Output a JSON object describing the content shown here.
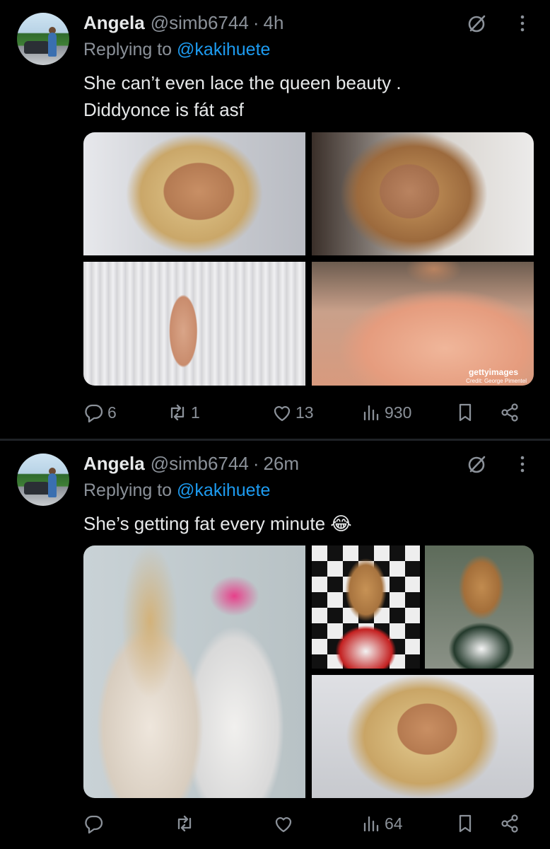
{
  "tweets": [
    {
      "author": {
        "name": "Angela",
        "handle": "@simb6744",
        "time": "4h"
      },
      "replying_to_label": "Replying to",
      "replying_to_handle": "@kakihuete",
      "text": "She can’t even lace the queen beauty .\nDiddyonce is fát asf",
      "media_watermark": "gettyimages",
      "media_watermark_credit": "Credit: George Pimentel",
      "stats": {
        "replies": "6",
        "reposts": "1",
        "likes": "13",
        "views": "930"
      }
    },
    {
      "author": {
        "name": "Angela",
        "handle": "@simb6744",
        "time": "26m"
      },
      "replying_to_label": "Replying to",
      "replying_to_handle": "@kakihuete",
      "text": "She’s getting fat every minute 😂",
      "stats": {
        "replies": "",
        "reposts": "",
        "likes": "",
        "views": "64"
      }
    }
  ],
  "theme": {
    "background": "#000000",
    "text": "#e7e9ea",
    "muted": "#8b9199",
    "link": "#1d9bf0"
  },
  "icons": [
    "grok-icon",
    "more-icon",
    "reply-icon",
    "repost-icon",
    "like-icon",
    "views-icon",
    "bookmark-icon",
    "share-icon"
  ]
}
